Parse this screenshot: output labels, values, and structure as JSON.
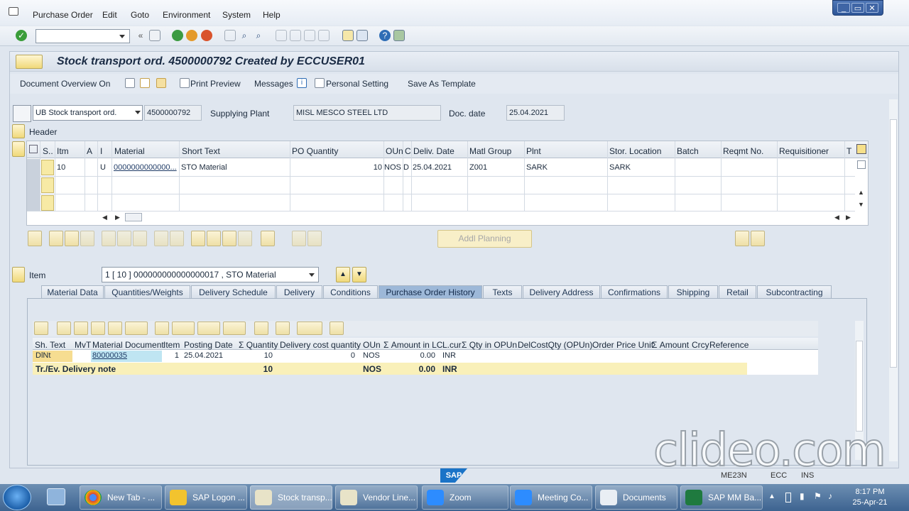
{
  "menu": [
    "Purchase Order",
    "Edit",
    "Goto",
    "Environment",
    "System",
    "Help"
  ],
  "window_controls": [
    "_",
    "▭",
    "✕"
  ],
  "title": "Stock transport ord. 4500000792 Created by ECCUSER01",
  "app_toolbar": {
    "doc_overview": "Document Overview On",
    "print_preview": "Print Preview",
    "messages": "Messages",
    "personal_setting": "Personal Setting",
    "save_as_template": "Save As Template"
  },
  "header": {
    "doc_type": "UB Stock transport ord.",
    "po_number": "4500000792",
    "supplying_plant_label": "Supplying Plant",
    "supplying_plant": "MISL MESCO STEEL LTD",
    "doc_date_label": "Doc. date",
    "doc_date": "25.04.2021",
    "header_label": "Header"
  },
  "items_grid": {
    "columns": [
      "S..",
      "Itm",
      "A",
      "I",
      "Material",
      "Short Text",
      "PO Quantity",
      "OUn",
      "C",
      "Deliv. Date",
      "Matl Group",
      "Plnt",
      "Stor. Location",
      "Batch",
      "Reqmt No.",
      "Requisitioner",
      "T"
    ],
    "rows": [
      {
        "itm": "10",
        "i": "U",
        "material": "0000000000000...",
        "short_text": "STO Material",
        "po_quantity": "10",
        "oun": "NOS",
        "c": "D",
        "deliv_date": "25.04.2021",
        "matl_group": "Z001",
        "plnt": "SARK",
        "stor_location": "SARK"
      }
    ]
  },
  "addl_planning": "Addl Planning",
  "item_section": {
    "label": "Item",
    "selected": "1 [ 10 ] 000000000000000017 , STO Material"
  },
  "tabs": [
    "Material Data",
    "Quantities/Weights",
    "Delivery Schedule",
    "Delivery",
    "Conditions",
    "Purchase Order History",
    "Texts",
    "Delivery Address",
    "Confirmations",
    "Shipping",
    "Retail",
    "Subcontracting"
  ],
  "active_tab": "Purchase Order History",
  "history": {
    "columns": [
      "Sh. Text",
      "MvT",
      "Material Document",
      "Item",
      "Posting Date",
      "Σ Quantity",
      "Delivery cost quantity",
      "OUn",
      "Σ Amount in LC",
      "L.cur",
      "Σ Qty in OPUn",
      "DelCostQty (OPUn)",
      "Order Price Unit",
      "Σ Amount",
      "Crcy",
      "Reference"
    ],
    "row": {
      "sh_text": "DlNt",
      "mat_doc": "80000035",
      "item": "1",
      "posting_date": "25.04.2021",
      "quantity": "10",
      "del_cost_qty": "0",
      "oun": "NOS",
      "amount_lc": "0.00",
      "lcur": "INR"
    },
    "total": {
      "label": "Tr./Ev. Delivery note",
      "quantity": "10",
      "oun": "NOS",
      "amount": "0.00",
      "cur": "INR"
    }
  },
  "status": {
    "sap": "SAP",
    "tx": "ME23N",
    "sys": "ECC",
    "mode": "INS"
  },
  "watermark": "clideo.com",
  "taskbar": [
    "New Tab - ...",
    "SAP Logon ...",
    "Stock transp...",
    "Vendor Line...",
    "Zoom",
    "Meeting Co...",
    "Documents",
    "SAP MM Ba..."
  ],
  "clock": {
    "time": "8:17 PM",
    "date": "25-Apr-21"
  }
}
